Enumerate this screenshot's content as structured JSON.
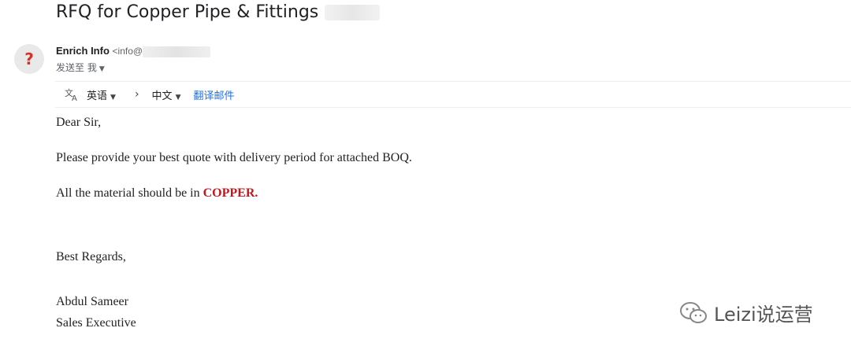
{
  "email": {
    "subject": "RFQ for Copper Pipe & Fittings",
    "sender_name": "Enrich Info",
    "sender_email_prefix": "<info@",
    "recipient_line": "发送至 我",
    "avatar_glyph": "?"
  },
  "translate_bar": {
    "source_lang": "英语",
    "target_lang": "中文",
    "translate_link": "翻译邮件"
  },
  "message": {
    "greeting": "Dear Sir,",
    "line1": "Please provide your best quote with delivery period for attached BOQ.",
    "line2_prefix": "All the material should be in ",
    "line2_highlight": "COPPER.",
    "closing": "Best Regards,",
    "signature_name": "Abdul Sameer",
    "signature_title": "Sales Executive"
  },
  "watermark": {
    "text": "Leizi说运营"
  },
  "colors": {
    "highlight": "#c0191f",
    "link": "#1a73e8"
  }
}
